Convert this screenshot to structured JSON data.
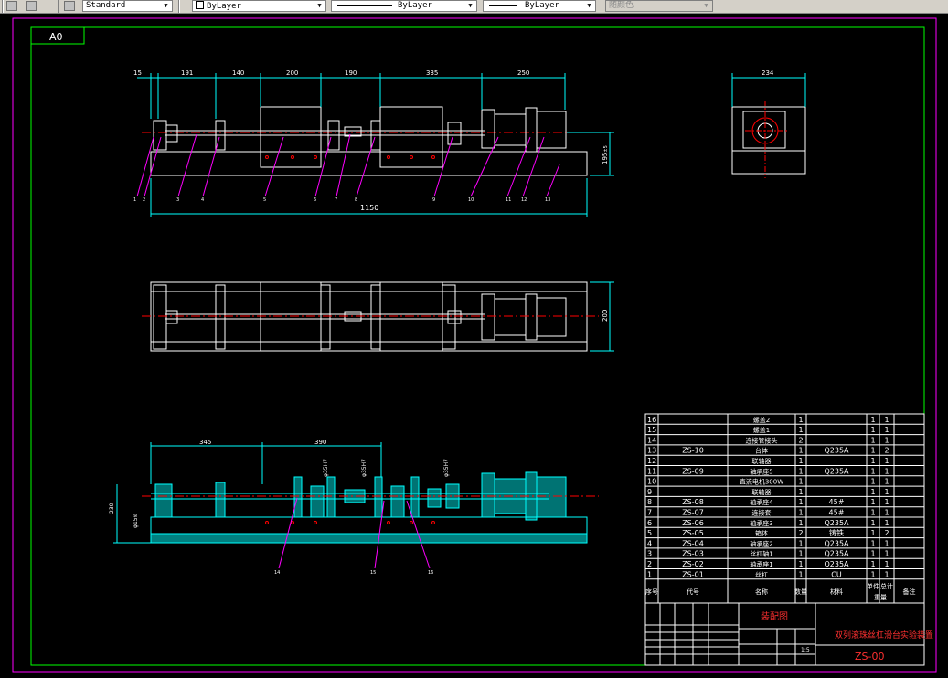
{
  "toolbar": {
    "text_style": "Standard",
    "layer_color": "ByLayer",
    "linetype": "ByLayer",
    "lineweight": "ByLayer",
    "plot_style": "随颜色"
  },
  "drawing": {
    "sheet_size": "A0",
    "front_view_dims": [
      "15",
      "191",
      "140",
      "200",
      "190",
      "335",
      "250"
    ],
    "overall_length": "1150",
    "height_dim": "195",
    "height_dim_suffix": "±5",
    "side_view_width": "234",
    "top_view_depth": "200",
    "section_dims": [
      "345",
      "390"
    ],
    "section_height": "230",
    "section_dia": "φ15",
    "section_dia_suffix": "f6",
    "section_fits": [
      "φ35H7",
      "φ35H7",
      "φ35H7"
    ],
    "balloons_front": [
      "1",
      "2",
      "3",
      "4",
      "5",
      "6",
      "7",
      "8",
      "9",
      "10",
      "11",
      "12",
      "13"
    ],
    "balloons_section": [
      "14",
      "15",
      "16"
    ]
  },
  "bom": {
    "rows": [
      {
        "no": "16",
        "code": "",
        "name": "螺盖2",
        "qty": "1",
        "material": "",
        "w1": "1",
        "w2": "1"
      },
      {
        "no": "15",
        "code": "",
        "name": "螺盖1",
        "qty": "1",
        "material": "",
        "w1": "1",
        "w2": "1"
      },
      {
        "no": "14",
        "code": "",
        "name": "连接管接头",
        "qty": "2",
        "material": "",
        "w1": "1",
        "w2": "1"
      },
      {
        "no": "13",
        "code": "ZS-10",
        "name": "台体",
        "qty": "1",
        "material": "Q235A",
        "w1": "1",
        "w2": "2"
      },
      {
        "no": "12",
        "code": "",
        "name": "联轴器",
        "qty": "1",
        "material": "",
        "w1": "1",
        "w2": "1"
      },
      {
        "no": "11",
        "code": "ZS-09",
        "name": "轴承座5",
        "qty": "1",
        "material": "Q235A",
        "w1": "1",
        "w2": "1"
      },
      {
        "no": "10",
        "code": "",
        "name": "直流电机300W",
        "qty": "1",
        "material": "",
        "w1": "1",
        "w2": "1"
      },
      {
        "no": "9",
        "code": "",
        "name": "联轴器",
        "qty": "1",
        "material": "",
        "w1": "1",
        "w2": "1"
      },
      {
        "no": "8",
        "code": "ZS-08",
        "name": "轴承座4",
        "qty": "1",
        "material": "45#",
        "w1": "1",
        "w2": "1"
      },
      {
        "no": "7",
        "code": "ZS-07",
        "name": "连接套",
        "qty": "1",
        "material": "45#",
        "w1": "1",
        "w2": "1"
      },
      {
        "no": "6",
        "code": "ZS-06",
        "name": "轴承座3",
        "qty": "1",
        "material": "Q235A",
        "w1": "1",
        "w2": "1"
      },
      {
        "no": "5",
        "code": "ZS-05",
        "name": "箱体",
        "qty": "2",
        "material": "铸铁",
        "w1": "1",
        "w2": "2"
      },
      {
        "no": "4",
        "code": "ZS-04",
        "name": "轴承座2",
        "qty": "1",
        "material": "Q235A",
        "w1": "1",
        "w2": "1"
      },
      {
        "no": "3",
        "code": "ZS-03",
        "name": "丝杠轴1",
        "qty": "1",
        "material": "Q235A",
        "w1": "1",
        "w2": "1"
      },
      {
        "no": "2",
        "code": "ZS-02",
        "name": "轴承座1",
        "qty": "1",
        "material": "Q235A",
        "w1": "1",
        "w2": "1"
      },
      {
        "no": "1",
        "code": "ZS-01",
        "name": "丝杠",
        "qty": "1",
        "material": "CU",
        "w1": "1",
        "w2": "1"
      }
    ],
    "header": {
      "no": "序号",
      "code": "代号",
      "name": "名称",
      "qty": "数量",
      "material": "材料",
      "unit_weight": "单件",
      "total_weight": "总计",
      "weight": "重量",
      "remark": "备注"
    }
  },
  "title_block": {
    "drawing_name": "装配图",
    "project_title": "双列滚珠丝杠滑台实验装置",
    "drawing_no": "ZS-00",
    "scale": "1:5"
  },
  "colors": {
    "cyan": "#00ffff",
    "red": "#ff0000",
    "white": "#ffffff",
    "green": "#00ff00",
    "magenta": "#ff00ff",
    "title_red": "#ff3030"
  }
}
